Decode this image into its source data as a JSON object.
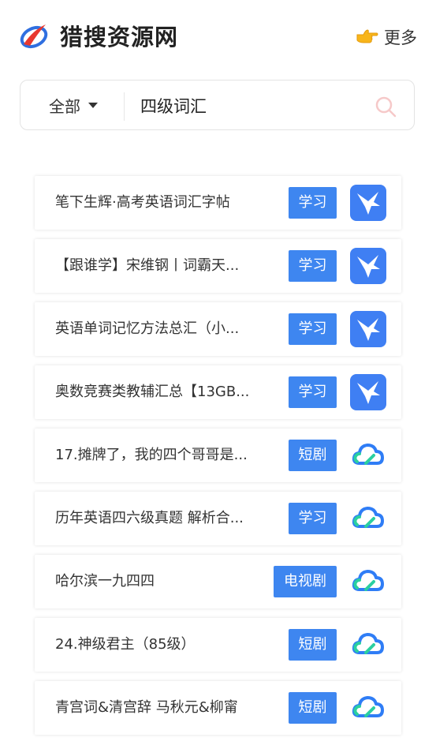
{
  "header": {
    "site_title": "猎搜资源网",
    "more_label": "更多",
    "logo_icon": "brand-logo-icon",
    "more_icon": "pointing-hand-icon"
  },
  "search": {
    "category": "全部",
    "query": "四级词汇"
  },
  "colors": {
    "tag_blue": "#3e86f0",
    "xunlei_blue": "#3f7ff3",
    "cloud_blue": "#2f7df6",
    "cloud_green": "#2bd0a0"
  },
  "results": [
    {
      "title": "笔下生辉·高考英语词汇字帖",
      "tag": "学习",
      "source_icon": "xunlei-bird-icon"
    },
    {
      "title": "【跟谁学】宋维钢丨词霸天...",
      "tag": "学习",
      "source_icon": "xunlei-bird-icon"
    },
    {
      "title": "英语单词记忆方法总汇（小...",
      "tag": "学习",
      "source_icon": "xunlei-bird-icon"
    },
    {
      "title": "奥数竞赛类教辅汇总【13GB...",
      "tag": "学习",
      "source_icon": "xunlei-bird-icon"
    },
    {
      "title": "17.摊牌了，我的四个哥哥是...",
      "tag": "短剧",
      "source_icon": "cloud-drive-icon"
    },
    {
      "title": "历年英语四六级真题 解析合...",
      "tag": "学习",
      "source_icon": "cloud-drive-icon"
    },
    {
      "title": "哈尔滨一九四四",
      "tag": "电视剧",
      "source_icon": "cloud-drive-icon"
    },
    {
      "title": "24.神级君主（85级）",
      "tag": "短剧",
      "source_icon": "cloud-drive-icon"
    },
    {
      "title": "青宫词&清宫辞 马秋元&柳甯",
      "tag": "短剧",
      "source_icon": "cloud-drive-icon"
    }
  ]
}
